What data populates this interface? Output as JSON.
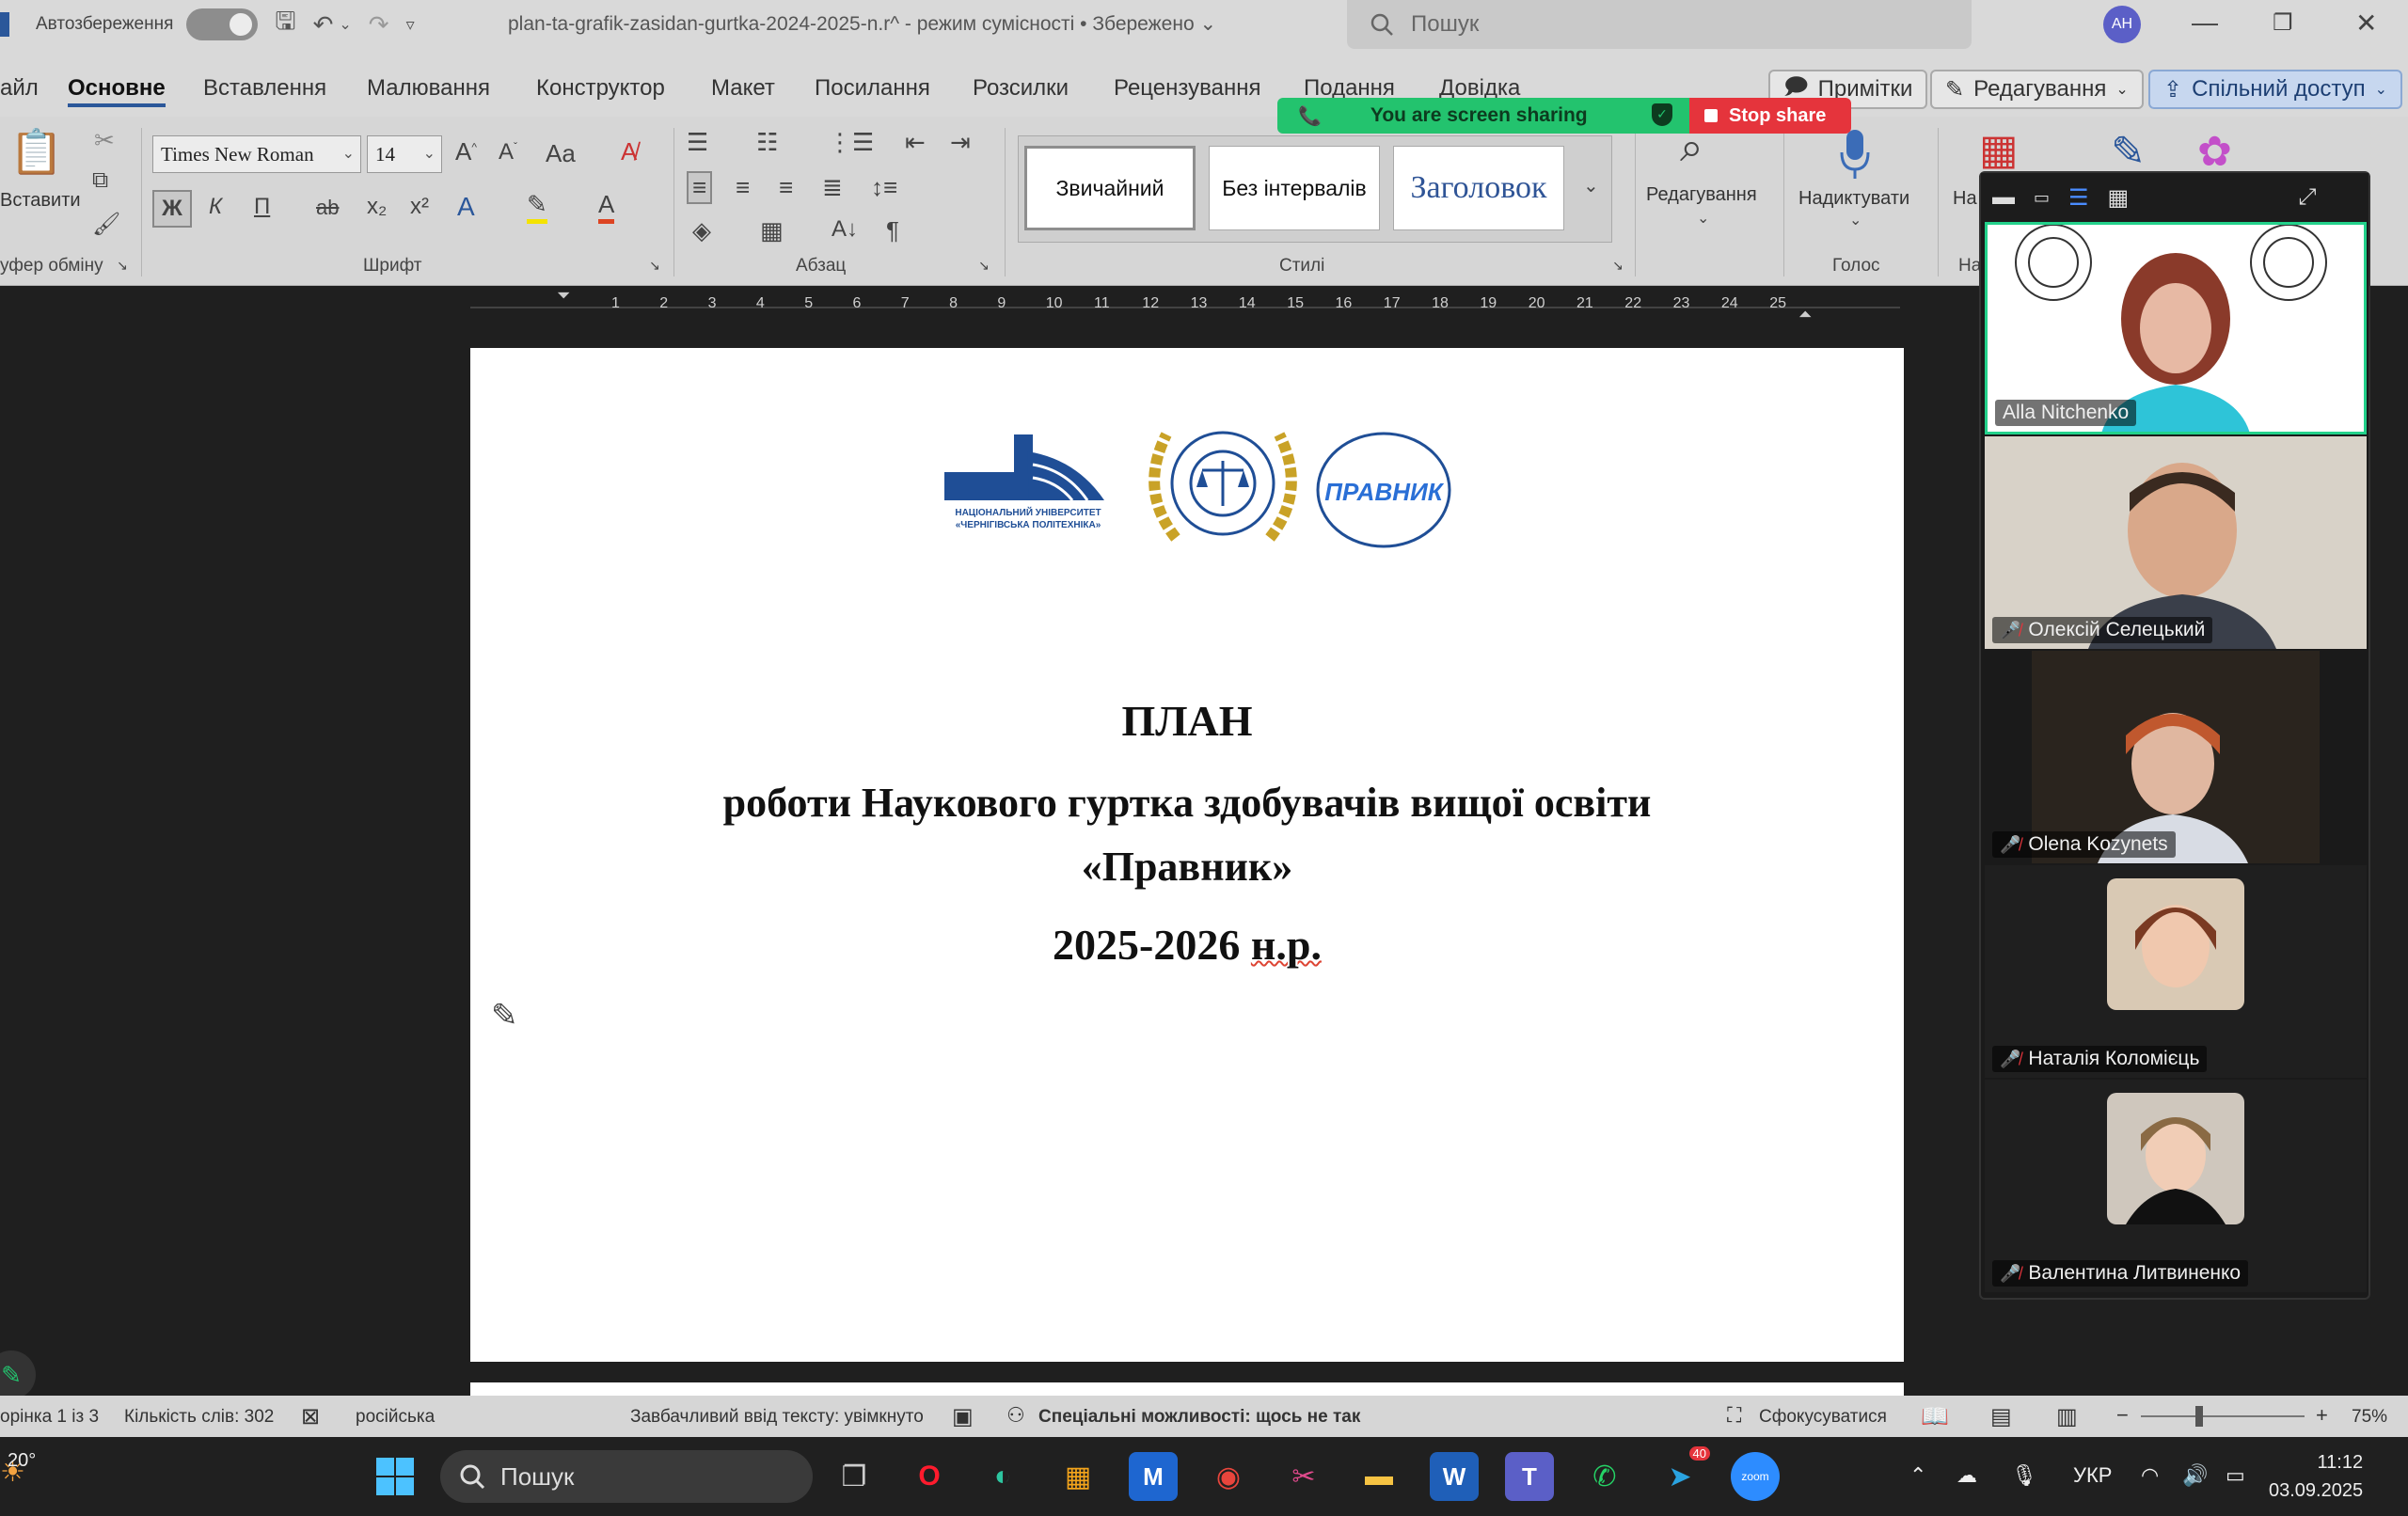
{
  "titlebar": {
    "autosave_label": "Автозбереження",
    "doc_title": "plan-ta-grafik-zasidan-gurtka-2024-2025-n.r^  -  режим сумісності • Збережено ⌄",
    "search_placeholder": "Пошук",
    "avatar_initials": "AH"
  },
  "tabs": {
    "items": [
      "айл",
      "Основне",
      "Вставлення",
      "Малювання",
      "Конструктор",
      "Макет",
      "Посилання",
      "Розсилки",
      "Рецензування",
      "Подання",
      "Довідка"
    ],
    "notes_label": "Примітки",
    "editing_label": "Редагування",
    "share_label": "Спільний доступ"
  },
  "screenshare": {
    "label": "You are screen sharing",
    "stop_label": "Stop share"
  },
  "ribbon": {
    "paste_label": "Вставити",
    "clipboard_label": "уфер обміну",
    "font_name": "Times New Roman",
    "font_size": "14",
    "font_group_label": "Шрифт",
    "bold": "Ж",
    "italic": "К",
    "underline": "П",
    "strike": "ab",
    "subscript": "x₂",
    "superscript": "x²",
    "change_case": "Aa",
    "paragraph_label": "Абзац",
    "styles_label": "Стилі",
    "styles": [
      "Звичайний",
      "Без інтервалів",
      "Заголовок"
    ],
    "editing_label": "Редагування",
    "dictate_label": "Надиктувати",
    "voice_label": "Голос",
    "cut_group_1": "На",
    "cut_group_2": "На"
  },
  "ruler": {
    "numbers": [
      "1",
      "2",
      "3",
      "4",
      "5",
      "6",
      "7",
      "8",
      "9",
      "10",
      "11",
      "12",
      "13",
      "14",
      "15",
      "16",
      "17",
      "18",
      "19",
      "20",
      "21",
      "22",
      "23",
      "24",
      "25"
    ]
  },
  "document": {
    "logo1_line1": "НАЦІОНАЛЬНИЙ УНІВЕРСИТЕТ",
    "logo1_line2": "«ЧЕРНІГІВСЬКА ПОЛІТЕХНІКА»",
    "logo3_text": "ПРАВНИК",
    "title": "ПЛАН",
    "subtitle_line1": "роботи Наукового гуртка здобувачів вищої освіти",
    "subtitle_line2": "«Правник»",
    "year_prefix": "2025-2026 ",
    "year_suffix": "н.р."
  },
  "zoom": {
    "participants": [
      {
        "name": "Alla Nitchenko",
        "muted": false,
        "active": true
      },
      {
        "name": "Олексій Селецький",
        "muted": true,
        "active": false
      },
      {
        "name": "Olena Kozynets",
        "muted": true,
        "active": false
      },
      {
        "name": "Наталія Коломієць",
        "muted": true,
        "active": false
      },
      {
        "name": "Валентина Литвиненко",
        "muted": true,
        "active": false
      }
    ]
  },
  "statusbar": {
    "page": "орінка 1 із 3",
    "words": "Кількість слів: 302",
    "language": "російська",
    "predictive": "Завбачливий ввід тексту: увімкнуто",
    "accessibility": "Спеціальні можливості: щось не так",
    "focus": "Сфокусуватися",
    "zoom": "75%"
  },
  "taskbar": {
    "weather": "20°",
    "search_placeholder": "Пошук",
    "language": "УКР",
    "time": "11:12",
    "date": "03.09.2025",
    "telegram_badge": "40"
  },
  "colors": {
    "accent": "#2b579a",
    "share_green": "#23c36e",
    "stop_red": "#e5343c",
    "active_speaker": "#23d18b"
  }
}
